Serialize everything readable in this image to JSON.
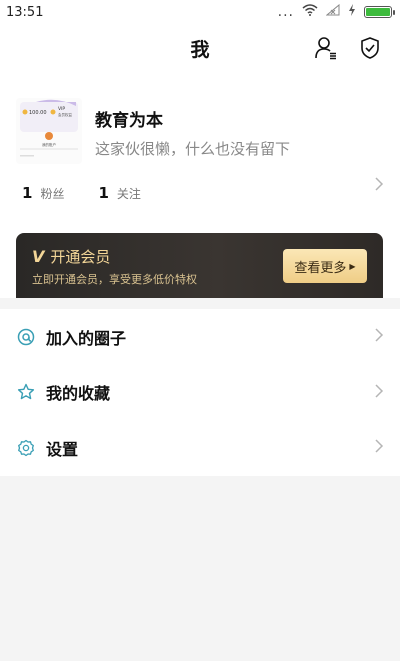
{
  "status_bar": {
    "time": "13:51",
    "dots": "...",
    "battery_level": 1.0
  },
  "header": {
    "title": "我",
    "actions": [
      {
        "icon": "user-list-icon"
      },
      {
        "icon": "shield-check-icon"
      }
    ]
  },
  "profile": {
    "avatar_texts": [
      "100.00",
      "VIP",
      "会员权益",
      "我的账户"
    ],
    "name": "教育为本",
    "bio": "这家伙很懒，什么也没有留下",
    "stats": [
      {
        "count": "1",
        "label": "粉丝"
      },
      {
        "count": "1",
        "label": "关注"
      }
    ]
  },
  "vip": {
    "badge": "V",
    "title": "开通会员",
    "subtitle": "立即开通会员，享受更多低价特权",
    "button_label": "查看更多",
    "colors": {
      "accent": "#f3d698",
      "background": "#2e2a27",
      "button": "#f5d898"
    }
  },
  "menu": {
    "items": [
      {
        "label": "加入的圈子",
        "icon": "circle-at-icon"
      },
      {
        "label": "我的收藏",
        "icon": "star-icon"
      },
      {
        "label": "设置",
        "icon": "gear-icon"
      }
    ],
    "icon_color": "#3a9fb5"
  }
}
